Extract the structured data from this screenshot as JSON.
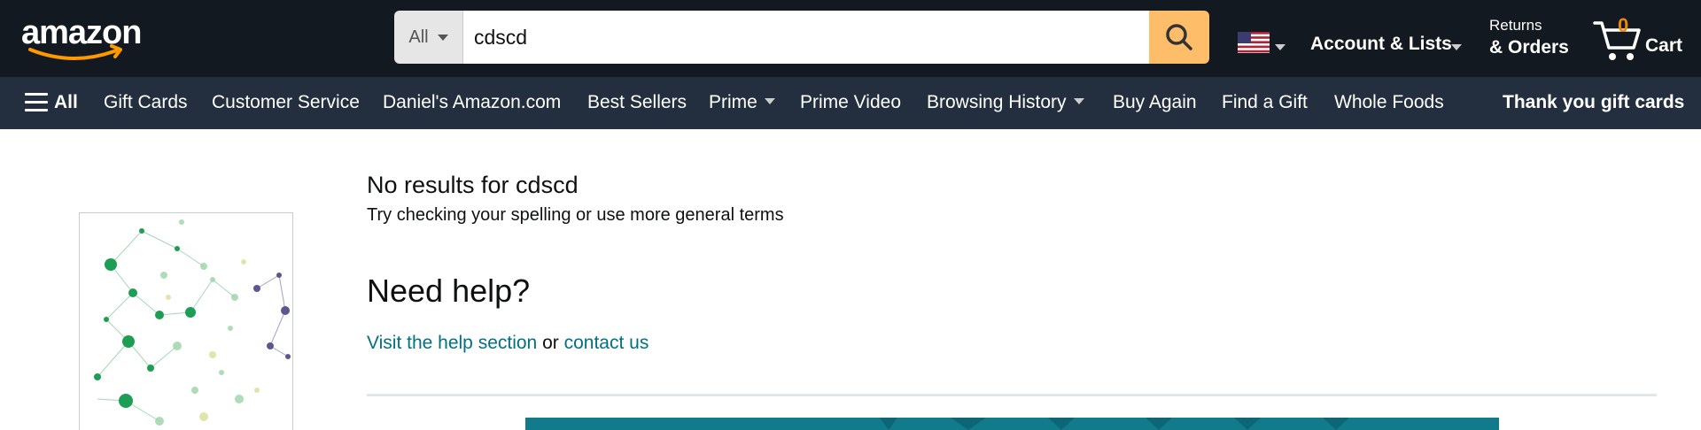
{
  "header": {
    "logo_text": "amazon",
    "search": {
      "department": "All",
      "query": "cdscd"
    },
    "account_label": "Account & Lists",
    "returns_line1": "Returns",
    "returns_line2": "& Orders",
    "cart_count": "0",
    "cart_label": "Cart"
  },
  "subnav": {
    "all_label": "All",
    "items": [
      "Gift Cards",
      "Customer Service",
      "Daniel's Amazon.com",
      "Best Sellers",
      "Prime",
      "Prime Video",
      "Browsing History",
      "Buy Again",
      "Find a Gift",
      "Whole Foods"
    ],
    "promo": "Thank you gift cards"
  },
  "main": {
    "no_results": "No results for cdscd",
    "tip": "Try checking your spelling or use more general terms",
    "need_help": "Need help?",
    "help_link": "Visit the help section",
    "or_text": "or",
    "contact_link": "contact us"
  },
  "colors": {
    "nav_top": "#131921",
    "nav_sub": "#232f3e",
    "search_button": "#febd69",
    "cart_count": "#f08804",
    "link": "#007185"
  }
}
